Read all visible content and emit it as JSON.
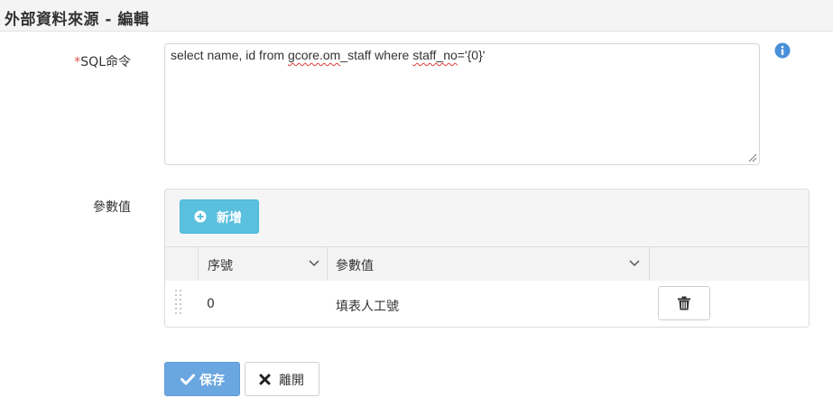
{
  "header": {
    "title": "外部資料來源 - 編輯"
  },
  "form": {
    "sql_label_required": "*",
    "sql_label": "SQL命令",
    "sql_value_parts": [
      "select name, id from ",
      "gcore.om",
      "_staff where ",
      "staff_no",
      "='{0}'"
    ],
    "params_label": "參數值"
  },
  "params": {
    "add_button_label": "新增",
    "columns": [
      {
        "label": "序號"
      },
      {
        "label": "參數值"
      }
    ],
    "rows": [
      {
        "seq": "0",
        "value": "填表人工號"
      }
    ]
  },
  "actions": {
    "save_label": "保存",
    "leave_label": "離開"
  },
  "colors": {
    "required": "#d9534f",
    "info_button": "#5bc0de",
    "save_button": "#6aa6e0",
    "info_icon": "#4a90d9"
  },
  "icons": {
    "info": "info-circle-icon",
    "add": "plus-circle-icon",
    "sort": "chevron-down-icon",
    "drag": "drag-handle-icon",
    "delete": "trash-icon",
    "save": "check-icon",
    "leave": "close-x-icon"
  }
}
